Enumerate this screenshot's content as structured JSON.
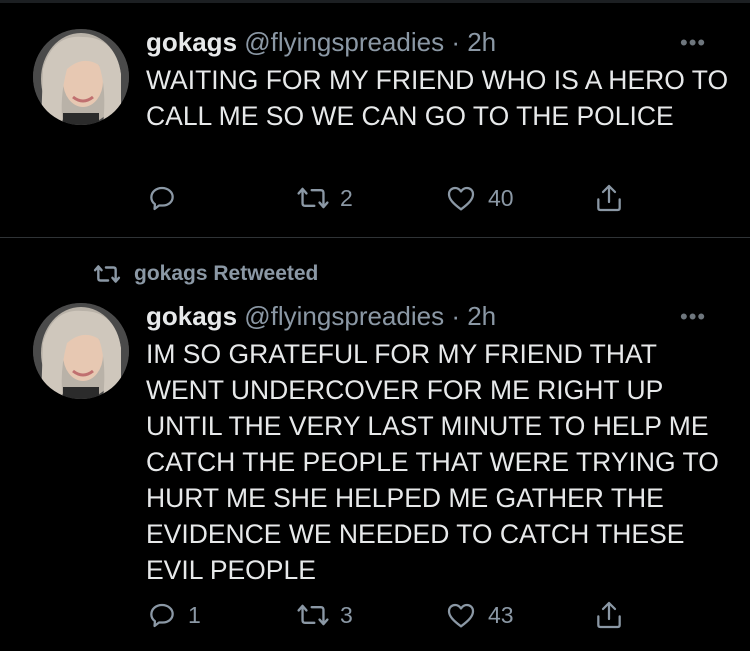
{
  "tweets": [
    {
      "author": "gokags",
      "handle": "@flyingspreadies",
      "time": "· 2h",
      "text": "WAITING FOR MY FRIEND WHO IS A HERO TO CALL ME SO WE CAN GO TO THE POLICE",
      "more_icon": "•••",
      "replies": "",
      "retweets": "2",
      "likes": "40"
    },
    {
      "author": "gokags",
      "handle": "@flyingspreadies",
      "time": "· 2h",
      "text": "IM SO GRATEFUL FOR MY FRIEND THAT WENT UNDERCOVER FOR ME RIGHT UP UNTIL THE VERY LAST MINUTE TO HELP ME CATCH THE PEOPLE THAT WERE TRYING TO HURT ME SHE HELPED ME GATHER THE EVIDENCE WE NEEDED TO CATCH THESE EVIL PEOPLE",
      "more_icon": "•••",
      "replies": "1",
      "retweets": "3",
      "likes": "43"
    }
  ],
  "retweet_notice": "gokags Retweeted",
  "colors": {
    "background": "#000000",
    "text": "#e7e9ea",
    "muted": "#8b98a5",
    "divider": "#2f3336"
  },
  "icons": [
    "reply-icon",
    "retweet-icon",
    "like-icon",
    "share-icon",
    "more-icon",
    "avatar"
  ]
}
